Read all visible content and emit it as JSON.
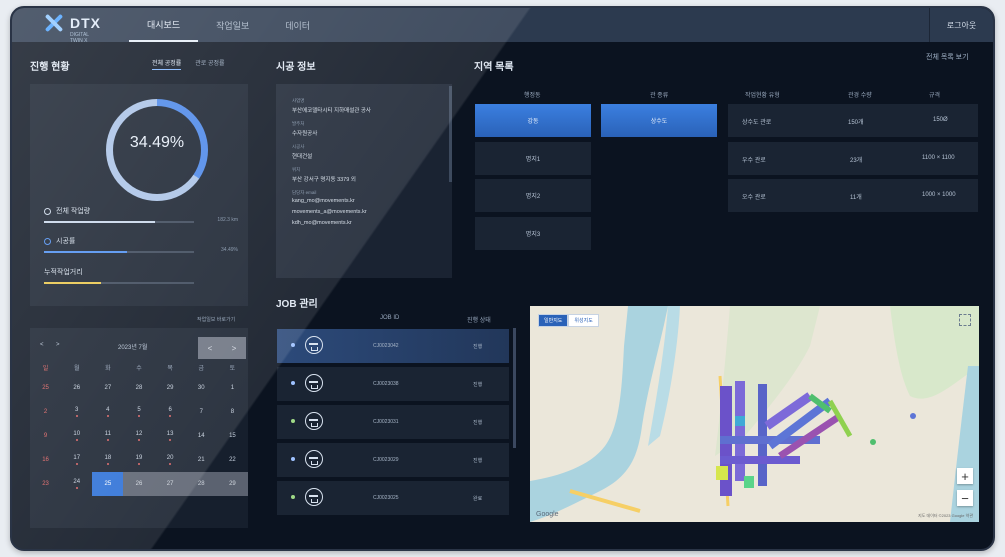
{
  "app": {
    "logo_text": "DTX",
    "logo_sub": "DIGITAL TWIN X"
  },
  "nav": {
    "items": [
      "대시보드",
      "작업일보",
      "데이터"
    ],
    "logout": "로그아웃"
  },
  "status": {
    "title": "진행 현황",
    "tabs": [
      "전체 공정률",
      "관로 공정률"
    ],
    "percent": "34.49%",
    "percent_value": 34.49,
    "items": [
      {
        "label": "전체 작업량",
        "fill": 0.74,
        "value": "182.3 km",
        "color": "#c8d6ea"
      },
      {
        "label": "시공률",
        "fill": 0.55,
        "value": "34.49%",
        "color": "#4c8ef0"
      },
      {
        "label": "누적작업거리",
        "fill": 0.38,
        "value": "",
        "sub": "",
        "color": "#e9c64a"
      }
    ]
  },
  "calendar": {
    "link": "작업일보 바로가기",
    "prev": "<",
    "next": ">",
    "month": "2023년 7월",
    "today_btns": [
      "<",
      ">"
    ],
    "dow": [
      "일",
      "월",
      "화",
      "수",
      "목",
      "금",
      "토"
    ],
    "weeks": [
      [
        "25",
        "26",
        "27",
        "28",
        "29",
        "30",
        "1"
      ],
      [
        "2",
        "3",
        "4",
        "5",
        "6",
        "7",
        "8"
      ],
      [
        "9",
        "10",
        "11",
        "12",
        "13",
        "14",
        "15"
      ],
      [
        "16",
        "17",
        "18",
        "19",
        "20",
        "21",
        "22"
      ],
      [
        "23",
        "24",
        "25",
        "26",
        "27",
        "28",
        "29"
      ]
    ],
    "marked": [
      "1-1",
      "1-2",
      "1-3",
      "1-4",
      "2-1",
      "2-2",
      "2-3",
      "2-4",
      "3-1",
      "3-2",
      "3-3",
      "3-4",
      "4-1"
    ],
    "selected": "4-2",
    "grey": [
      "4-3",
      "4-4",
      "4-5",
      "4-6"
    ]
  },
  "info": {
    "title": "시공 정보",
    "items": [
      {
        "label": "사업명",
        "value": "부산에코델타시티 지하매설관 공사"
      },
      {
        "label": "발주처",
        "value": "수자원공사"
      },
      {
        "label": "시공사",
        "value": "현대건설"
      },
      {
        "label": "위치",
        "value": "부산 강서구 명지동 3379 외"
      }
    ],
    "emails_label": "담당자 email",
    "emails": [
      "kang_mo@movements.kr",
      "movements_a@movements.kr",
      "kdh_mo@movements.kr"
    ]
  },
  "region": {
    "title": "지역 목록",
    "more": "전체 목록 보기",
    "headers": [
      "행정동",
      "관 종류",
      "작업현황 유형",
      "관경 수량",
      "규격"
    ],
    "col1": [
      "강동",
      "명지1",
      "명지2",
      "명지3"
    ],
    "col2": [
      "상수도"
    ],
    "rows": [
      [
        "상수도 관로",
        "150개",
        "150Ø"
      ],
      [
        "우수 관로",
        "23개",
        "1100 × 1100"
      ],
      [
        "오수 관로",
        "11개",
        "1000 × 1000"
      ]
    ]
  },
  "jobs": {
    "title": "JOB 관리",
    "headers": [
      "JOB ID",
      "진행 상태"
    ],
    "rows": [
      {
        "id": "CJ0023042",
        "state": "진행",
        "dot": "#9fc2ff"
      },
      {
        "id": "CJ0023038",
        "state": "진행",
        "dot": "#9fc2ff"
      },
      {
        "id": "CJ0023031",
        "state": "진행",
        "dot": "#9fd987"
      },
      {
        "id": "CJ0023029",
        "state": "진행",
        "dot": "#9fc2ff"
      },
      {
        "id": "CJ0023025",
        "state": "완료",
        "dot": "#9fd987"
      }
    ]
  },
  "map": {
    "tabs": [
      "일반지도",
      "위성지도"
    ],
    "zoom_in": "+",
    "zoom_out": "−",
    "google": "Google",
    "attribution": "지도 데이터 ©2023 Google 약관"
  }
}
